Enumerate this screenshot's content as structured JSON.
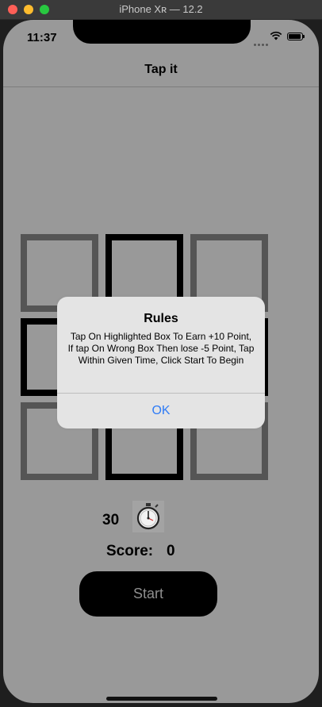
{
  "window": {
    "title": "iPhone Xʀ — 12.2"
  },
  "status_bar": {
    "time": "11:37"
  },
  "navbar": {
    "title": "Tap it"
  },
  "game": {
    "timer": "30",
    "score_label": "Score:",
    "score": "0",
    "start_label": "Start"
  },
  "alert": {
    "title": "Rules",
    "message": "Tap On Highlighted Box To Earn +10 Point, If tap On Wrong Box Then lose -5 Point, Tap Within Given Time, Click Start To Begin",
    "ok_label": "OK"
  },
  "colors": {
    "screen_bg": "#999999",
    "box_gray": "#555555",
    "box_dark": "#000000",
    "alert_button": "#2f7cf6"
  },
  "icons": [
    "wifi-icon",
    "battery-icon",
    "stopwatch-icon"
  ]
}
